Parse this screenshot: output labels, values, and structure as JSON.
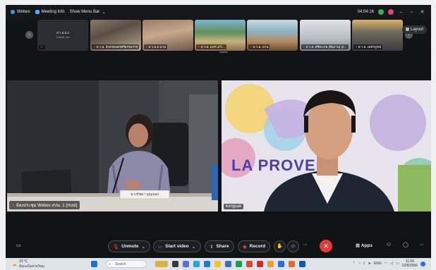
{
  "titlebar": {
    "app_name": "Webex",
    "meeting_info": "Meeting Info",
    "show_menu_bar": "Show Menu Bar",
    "timer": "04:04:16"
  },
  "filmstrip": {
    "thumbnails": [
      {
        "name": "Cristal, me",
        "center_line": "ส.ว.อ.ย.3"
      },
      {
        "name": "ส.ว.อ. จังหวัดนครศรีธรรมราช"
      },
      {
        "name": "ส.ว.อ.ย.น่าน"
      },
      {
        "name": "ส.ว.อ. แพร่ แก้ว..."
      },
      {
        "name": "ส.ว.อ. น่าน"
      },
      {
        "name": "ส.ว.อ. ศรีสะเกษ (ทีมงาน) (Z..."
      },
      {
        "name": "ส.ว.อ. เพชรบูรณ์"
      }
    ],
    "layout_label": "Layout"
  },
  "videos": {
    "left_label": "ห้องประชุม Webex สปน. 1 (Host)",
    "left_nameplate": "นางรัชดา บุญเจลง",
    "right_label": "kongsak",
    "right_banner": "LA PROVE"
  },
  "controls": {
    "unmute": "Unmute",
    "start_video": "Start video",
    "share": "Share",
    "record": "Record",
    "apps": "Apps"
  },
  "taskbar": {
    "temp": "31°C",
    "weather_desc": "มีเมฆเป็นส่วนใหญ่",
    "search_placeholder": "Search",
    "lang": "ENG",
    "time": "11:59",
    "date": "22/8/2566"
  },
  "colors": {
    "end_call": "#e03c3c",
    "webex_blue": "#3a9be6"
  }
}
